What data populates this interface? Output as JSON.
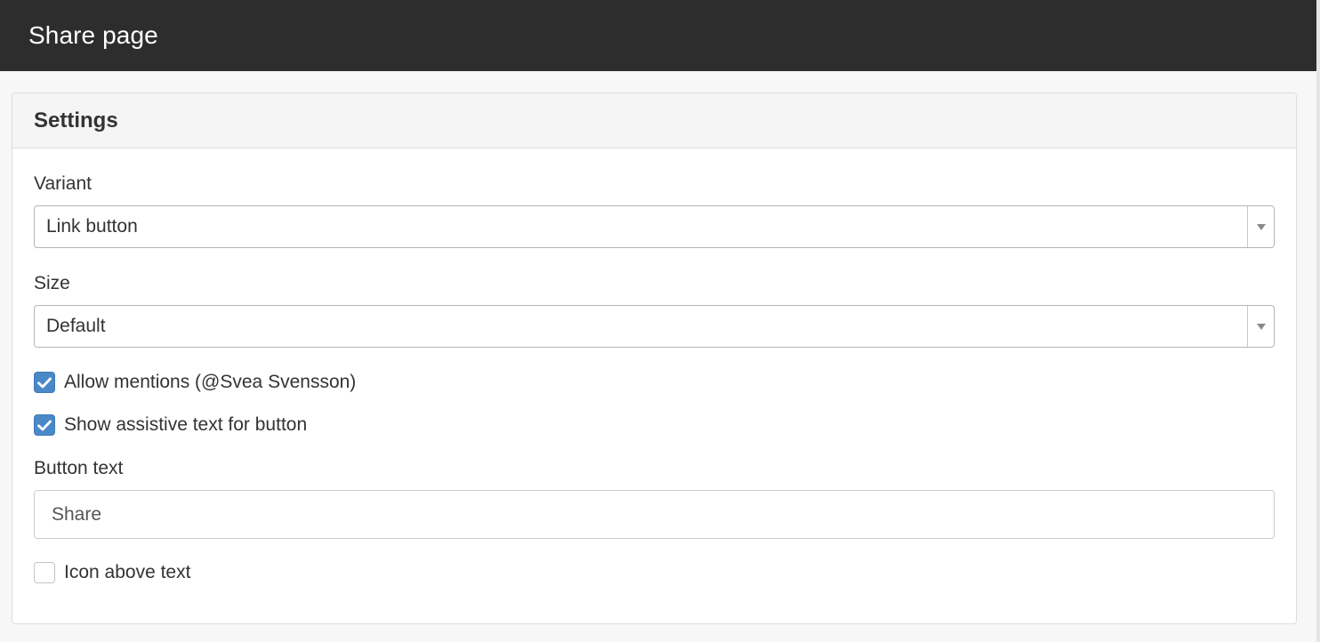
{
  "header": {
    "title": "Share page"
  },
  "settings": {
    "title": "Settings",
    "variant": {
      "label": "Variant",
      "value": "Link button"
    },
    "size": {
      "label": "Size",
      "value": "Default"
    },
    "allow_mentions": {
      "label": "Allow mentions (@Svea Svensson)",
      "checked": true
    },
    "assistive_text": {
      "label": "Show assistive text for button",
      "checked": true
    },
    "button_text": {
      "label": "Button text",
      "value": "Share",
      "placeholder": ""
    },
    "icon_above": {
      "label": "Icon above text",
      "checked": false
    }
  },
  "colors": {
    "topbar": "#2d2d2d",
    "checkbox_checked": "#4a88c8",
    "panel_header": "#f5f5f5"
  },
  "icons": {
    "select_arrow": "chevron-down-icon",
    "checkmark": "checkmark-icon"
  }
}
